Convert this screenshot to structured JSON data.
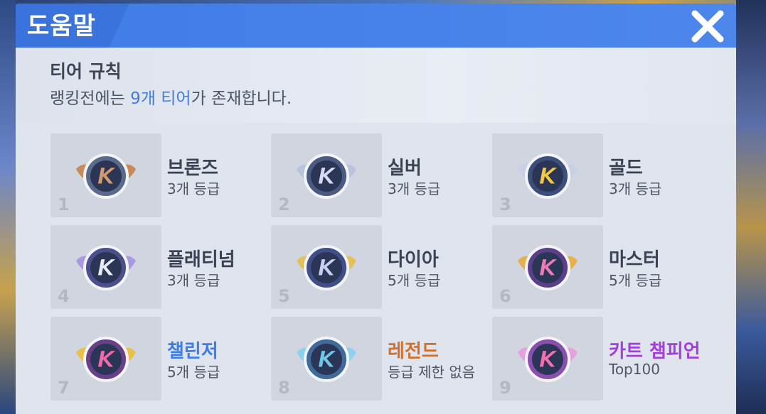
{
  "dialog": {
    "title": "도움말",
    "close_icon": "close-icon"
  },
  "rules": {
    "title": "티어 규칙",
    "desc_before": "랭킹전에는 ",
    "desc_highlight": "9개 티어",
    "desc_after": "가 존재합니다.",
    "highlight_color": "#3f7ce6"
  },
  "tiers": [
    {
      "num": "1",
      "name": "브론즈",
      "sub": "3개 등급",
      "name_color": "#3a4254",
      "icon": "bronze-badge-icon"
    },
    {
      "num": "2",
      "name": "실버",
      "sub": "3개 등급",
      "name_color": "#3a4254",
      "icon": "silver-badge-icon"
    },
    {
      "num": "3",
      "name": "골드",
      "sub": "3개 등급",
      "name_color": "#3a4254",
      "icon": "gold-badge-icon"
    },
    {
      "num": "4",
      "name": "플래티넘",
      "sub": "3개 등급",
      "name_color": "#3a4254",
      "icon": "platinum-badge-icon"
    },
    {
      "num": "5",
      "name": "다이아",
      "sub": "5개 등급",
      "name_color": "#3a4254",
      "icon": "diamond-badge-icon"
    },
    {
      "num": "6",
      "name": "마스터",
      "sub": "5개 등급",
      "name_color": "#3a4254",
      "icon": "master-badge-icon"
    },
    {
      "num": "7",
      "name": "챌린저",
      "sub": "5개 등급",
      "name_color": "#3f7ce6",
      "icon": "challenger-badge-icon"
    },
    {
      "num": "8",
      "name": "레전드",
      "sub": "등급 제한 없음",
      "name_color": "#d0702a",
      "icon": "legend-badge-icon"
    },
    {
      "num": "9",
      "name": "카트 챔피언",
      "sub": "Top100",
      "name_color": "#a23fd6",
      "icon": "kart-champion-badge-icon"
    }
  ]
}
